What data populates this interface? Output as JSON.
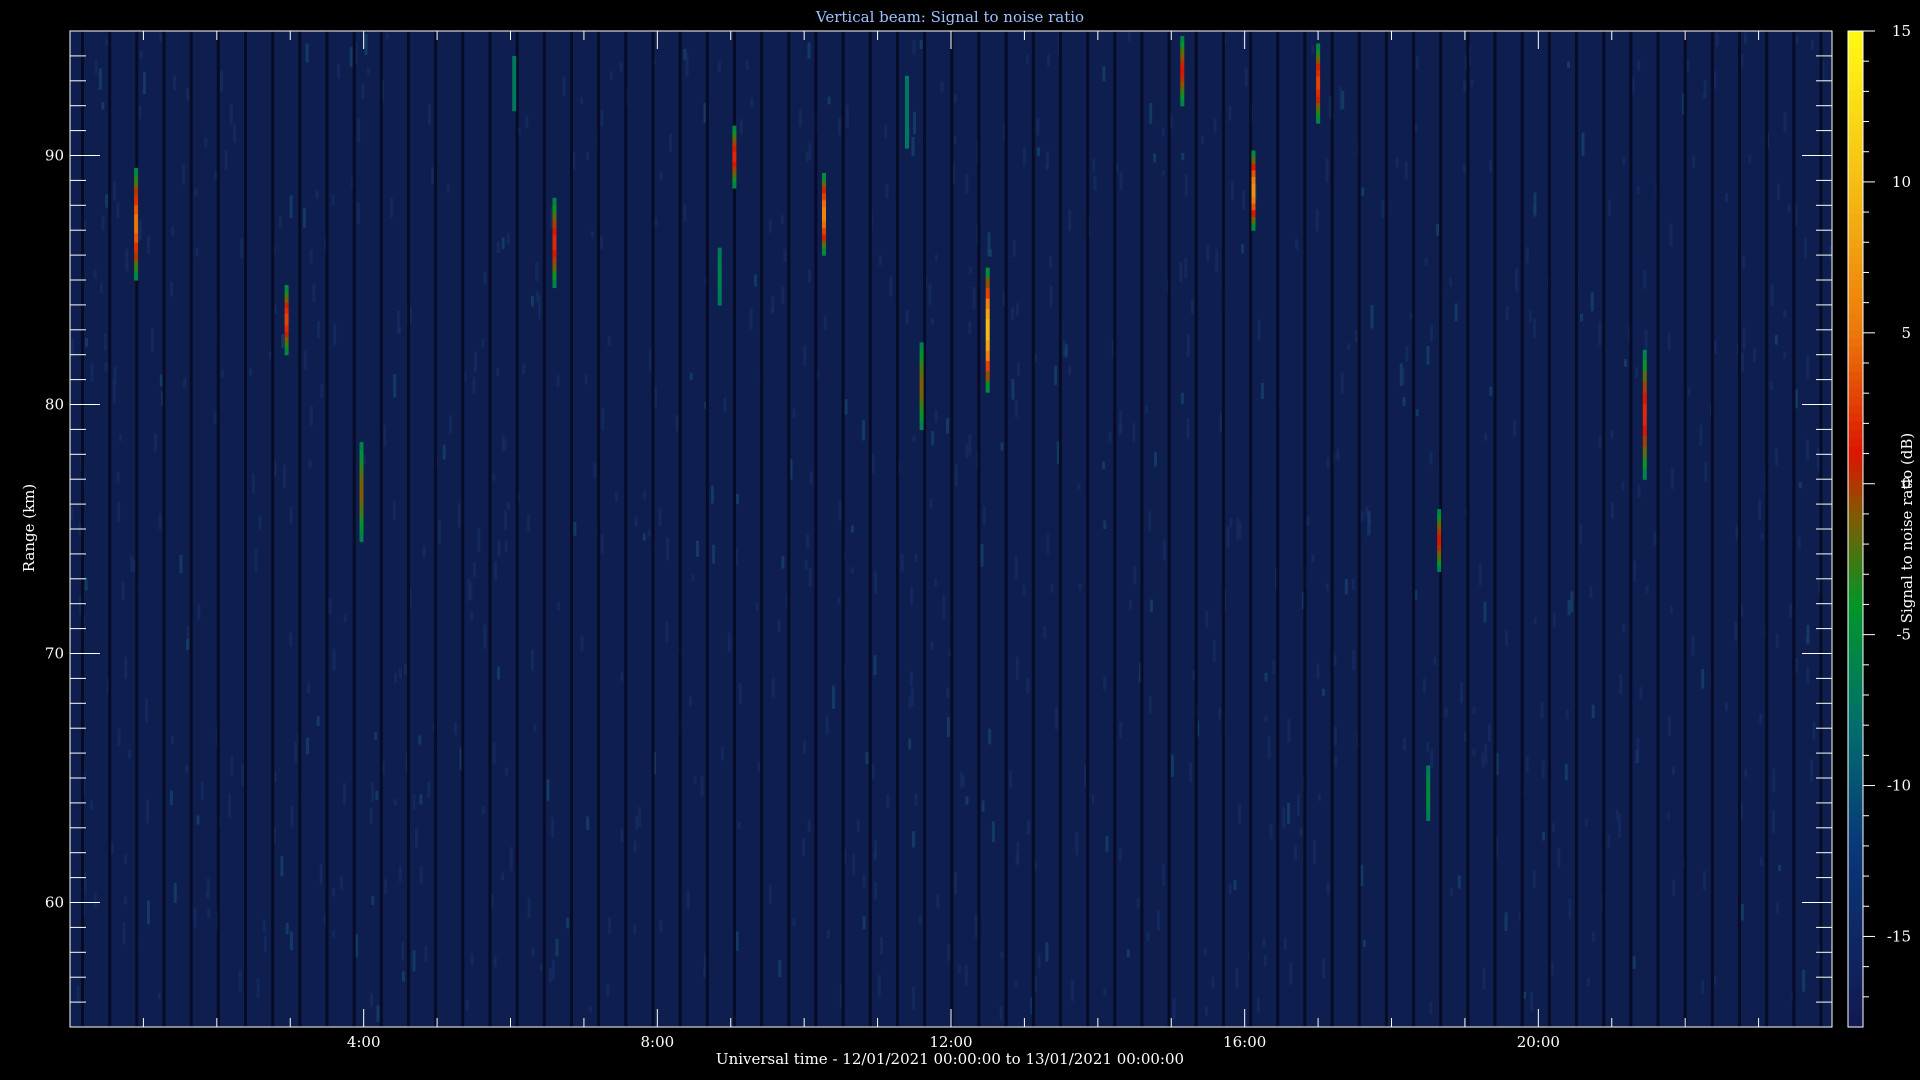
{
  "chart_data": {
    "type": "heatmap",
    "title": "Vertical beam: Signal to noise ratio",
    "xlabel": "Universal time - 12/01/2021 00:00:00 to 13/01/2021 00:00:00",
    "ylabel": "Range (km)",
    "colorbar_label": "Signal to noise ratio (dB)",
    "xlim": [
      0,
      24
    ],
    "ylim": [
      55,
      95
    ],
    "clim": [
      -18,
      15
    ],
    "x_ticks": [
      {
        "value": 4,
        "label": "4:00"
      },
      {
        "value": 8,
        "label": "8:00"
      },
      {
        "value": 12,
        "label": "12:00"
      },
      {
        "value": 16,
        "label": "16:00"
      },
      {
        "value": 20,
        "label": "20:00"
      }
    ],
    "y_ticks": [
      {
        "value": 60,
        "label": "60"
      },
      {
        "value": 70,
        "label": "70"
      },
      {
        "value": 80,
        "label": "80"
      },
      {
        "value": 90,
        "label": "90"
      }
    ],
    "colorbar_ticks": [
      {
        "value": 15,
        "label": "15"
      },
      {
        "value": 10,
        "label": "10"
      },
      {
        "value": 5,
        "label": "5"
      },
      {
        "value": 0,
        "label": "0"
      },
      {
        "value": -5,
        "label": "-5"
      },
      {
        "value": -10,
        "label": "-10"
      },
      {
        "value": -15,
        "label": "-15"
      }
    ],
    "background_snr": -15,
    "echoes": [
      {
        "time": 0.9,
        "range_min": 85.0,
        "range_max": 89.5,
        "snr_peak": 5
      },
      {
        "time": 2.95,
        "range_min": 82.0,
        "range_max": 84.8,
        "snr_peak": 3
      },
      {
        "time": 3.97,
        "range_min": 74.5,
        "range_max": 78.5,
        "snr_peak": -1
      },
      {
        "time": 6.05,
        "range_min": 91.8,
        "range_max": 94.0,
        "snr_peak": -7
      },
      {
        "time": 6.6,
        "range_min": 84.7,
        "range_max": 88.3,
        "snr_peak": 2
      },
      {
        "time": 8.85,
        "range_min": 84.0,
        "range_max": 86.3,
        "snr_peak": -6
      },
      {
        "time": 9.05,
        "range_min": 88.7,
        "range_max": 91.2,
        "snr_peak": 2
      },
      {
        "time": 10.27,
        "range_min": 86.0,
        "range_max": 89.3,
        "snr_peak": 6
      },
      {
        "time": 11.4,
        "range_min": 90.3,
        "range_max": 93.2,
        "snr_peak": -7
      },
      {
        "time": 11.6,
        "range_min": 79.0,
        "range_max": 82.5,
        "snr_peak": -1
      },
      {
        "time": 12.5,
        "range_min": 80.5,
        "range_max": 85.5,
        "snr_peak": 10
      },
      {
        "time": 15.15,
        "range_min": 92.0,
        "range_max": 94.8,
        "snr_peak": 1
      },
      {
        "time": 16.12,
        "range_min": 87.0,
        "range_max": 90.2,
        "snr_peak": 7
      },
      {
        "time": 17.0,
        "range_min": 91.3,
        "range_max": 94.5,
        "snr_peak": 3
      },
      {
        "time": 18.5,
        "range_min": 63.3,
        "range_max": 65.5,
        "snr_peak": -5
      },
      {
        "time": 18.65,
        "range_min": 73.3,
        "range_max": 75.8,
        "snr_peak": 1
      },
      {
        "time": 21.45,
        "range_min": 77.0,
        "range_max": 82.2,
        "snr_peak": 2
      }
    ],
    "legend": "colorbar-right",
    "grid": false
  }
}
